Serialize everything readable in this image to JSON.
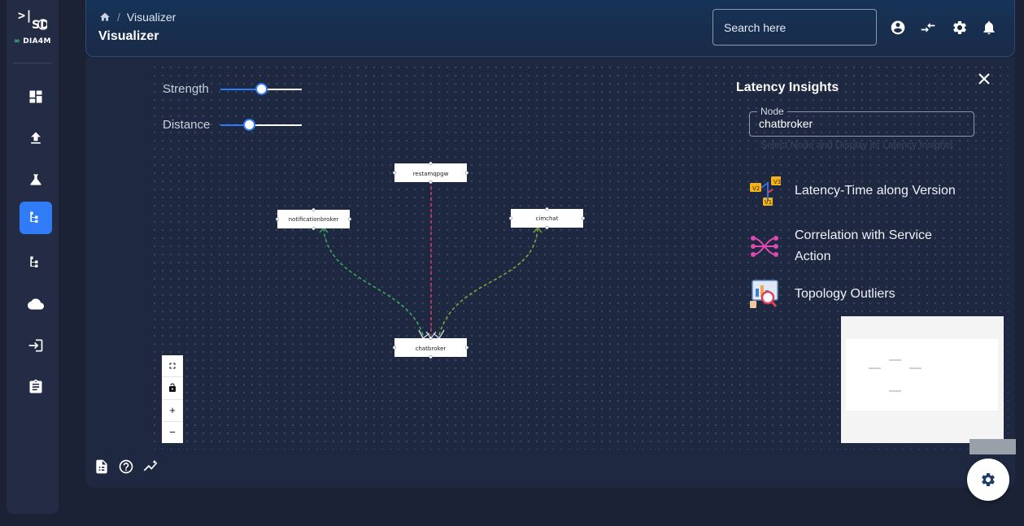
{
  "sidebar": {
    "collapse_glyph": ">|",
    "brand": "DIA4M",
    "logo_mark": "SD",
    "items": [
      {
        "name": "dashboard-icon",
        "active": false
      },
      {
        "name": "upload-icon",
        "active": false
      },
      {
        "name": "flask-icon",
        "active": false
      },
      {
        "name": "topology-icon",
        "active": true
      },
      {
        "name": "hierarchy-icon",
        "active": false
      },
      {
        "name": "cloud-icon",
        "active": false
      },
      {
        "name": "login-icon",
        "active": false
      },
      {
        "name": "clipboard-icon",
        "active": false
      }
    ]
  },
  "header": {
    "breadcrumb": "Visualizer",
    "breadcrumb_separator": "/",
    "title": "Visualizer",
    "search_placeholder": "Search here",
    "icons": [
      "account-icon",
      "compare-icon",
      "settings-icon",
      "notifications-icon"
    ]
  },
  "controls": {
    "strength": {
      "label": "Strength",
      "value": 0.5
    },
    "distance": {
      "label": "Distance",
      "value": 0.35
    }
  },
  "graph": {
    "nodes": [
      "restamqpgw",
      "notificationbroker",
      "cimchat",
      "chatbroker"
    ],
    "edges": [
      {
        "from": "restamqpgw",
        "to": "chatbroker",
        "color": "#d63a5a"
      },
      {
        "from": "chatbroker",
        "to": "notificationbroker",
        "color": "#3aa85a"
      },
      {
        "from": "chatbroker",
        "to": "cimchat",
        "color": "#7aa83a"
      }
    ]
  },
  "zoom_controls": [
    "fullscreen-icon",
    "lock-icon",
    "+",
    "−"
  ],
  "insights": {
    "title": "Latency Insights",
    "node_label": "Node",
    "node_value": "chatbroker",
    "helper": "Select Node and Display its Latency Insights",
    "items": [
      {
        "label": "Latency-Time along Version",
        "icon": "version-timeline-icon"
      },
      {
        "label": "Correlation with Service Action",
        "icon": "correlation-icon"
      },
      {
        "label": "Topology Outliers",
        "icon": "outlier-analysis-icon"
      }
    ]
  },
  "footer": {
    "icons": [
      "document-icon",
      "help-icon",
      "trend-icon"
    ]
  },
  "fab": {
    "icon": "settings-icon"
  },
  "colors": {
    "accent": "#2f7cf6",
    "background": "#1b2236",
    "panel": "#1e2840"
  }
}
